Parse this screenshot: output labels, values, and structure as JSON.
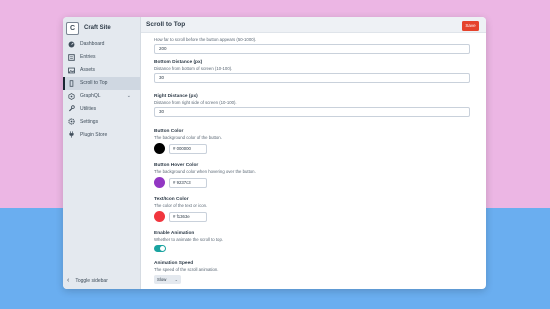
{
  "app": {
    "site_logo_letter": "C",
    "site_name": "Craft Site",
    "page_title": "Scroll to Top",
    "save_label": "Save"
  },
  "sidebar": {
    "items": [
      {
        "label": "Dashboard",
        "icon": "dashboard-icon"
      },
      {
        "label": "Entries",
        "icon": "entries-icon"
      },
      {
        "label": "Assets",
        "icon": "assets-icon"
      },
      {
        "label": "Scroll to Top",
        "icon": "scroll-to-top-icon",
        "active": true
      },
      {
        "label": "GraphQL",
        "icon": "graphql-icon",
        "has_submenu": true
      },
      {
        "label": "Utilities",
        "icon": "wrench-icon"
      },
      {
        "label": "Settings",
        "icon": "gear-icon"
      },
      {
        "label": "Plugin Store",
        "icon": "plug-icon"
      }
    ],
    "toggle_label": "Toggle sidebar"
  },
  "fields": {
    "scroll_offset": {
      "hint": "How far to scroll before the button appears (50-1000).",
      "value": "200"
    },
    "bottom_distance": {
      "label": "Bottom Distance (px)",
      "hint": "Distance from bottom of screen (10-100).",
      "value": "30"
    },
    "right_distance": {
      "label": "Right Distance (px)",
      "hint": "Distance from right side of screen (10-100).",
      "value": "30"
    },
    "button_color": {
      "label": "Button Color",
      "hint": "The background color of the button.",
      "value": "# 000000",
      "swatch": "#000000"
    },
    "button_hover_color": {
      "label": "Button Hover Color",
      "hint": "The background color when hovering over the button.",
      "value": "# 9237c3",
      "swatch": "#9237c3"
    },
    "text_icon_color": {
      "label": "Text/Icon Color",
      "hint": "The color of the text or icon.",
      "value": "# f1363e",
      "swatch": "#f1363e"
    },
    "enable_animation": {
      "label": "Enable Animation",
      "hint": "Whether to animate the scroll to top.",
      "enabled": true
    },
    "animation_speed": {
      "label": "Animation Speed",
      "hint": "The speed of the scroll animation.",
      "value": "Slow"
    }
  },
  "colors": {
    "accent": "#e5422b",
    "toggle_on": "#1aa3a0"
  }
}
